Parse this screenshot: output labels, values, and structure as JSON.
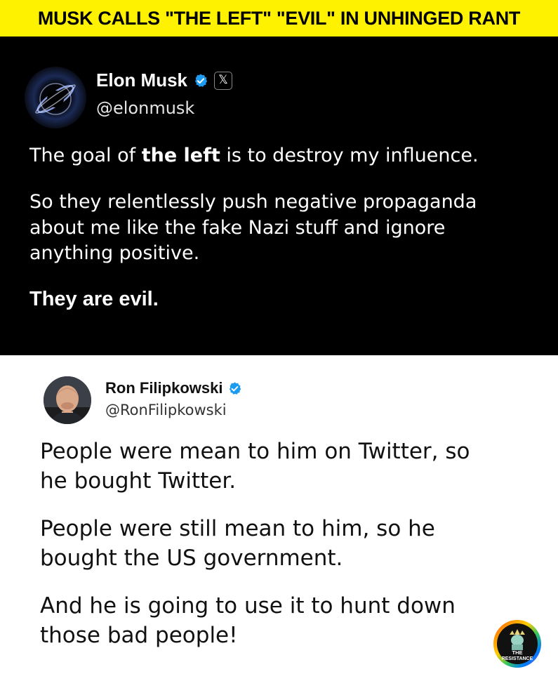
{
  "headline": "MUSK CALLS \"THE LEFT\" \"EVIL\" IN UNHINGED RANT",
  "tweet1": {
    "author": "Elon Musk",
    "handle": "@elonmusk",
    "verified_icon": "verified-badge-icon",
    "platform_icon": "x-logo-icon",
    "p1_before": "The goal of ",
    "p1_bold": "the left",
    "p1_after": " is to destroy my influence.",
    "p2_line1": "So they relentlessly push negative propaganda",
    "p2_line2": "about me like the fake Nazi stuff and ignore",
    "p2_line3": "anything positive.",
    "p3": "They are evil.",
    "background": "#000000"
  },
  "tweet2": {
    "author": "Ron Filipkowski",
    "handle": "@RonFilipkowski",
    "verified_icon": "verified-badge-icon",
    "p1_line1": "People were mean to him on Twitter, so",
    "p1_line2": "he bought Twitter.",
    "p2_line1": "People were still mean to him, so he",
    "p2_line2": "bought the US government.",
    "p3_line1": "And he is going to use it to hunt down",
    "p3_line2": "those bad people!"
  },
  "watermark": {
    "line1": "THE",
    "line2": "RESISTANCE"
  },
  "colors": {
    "banner": "#fff200",
    "verified": "#1d9bf0"
  }
}
